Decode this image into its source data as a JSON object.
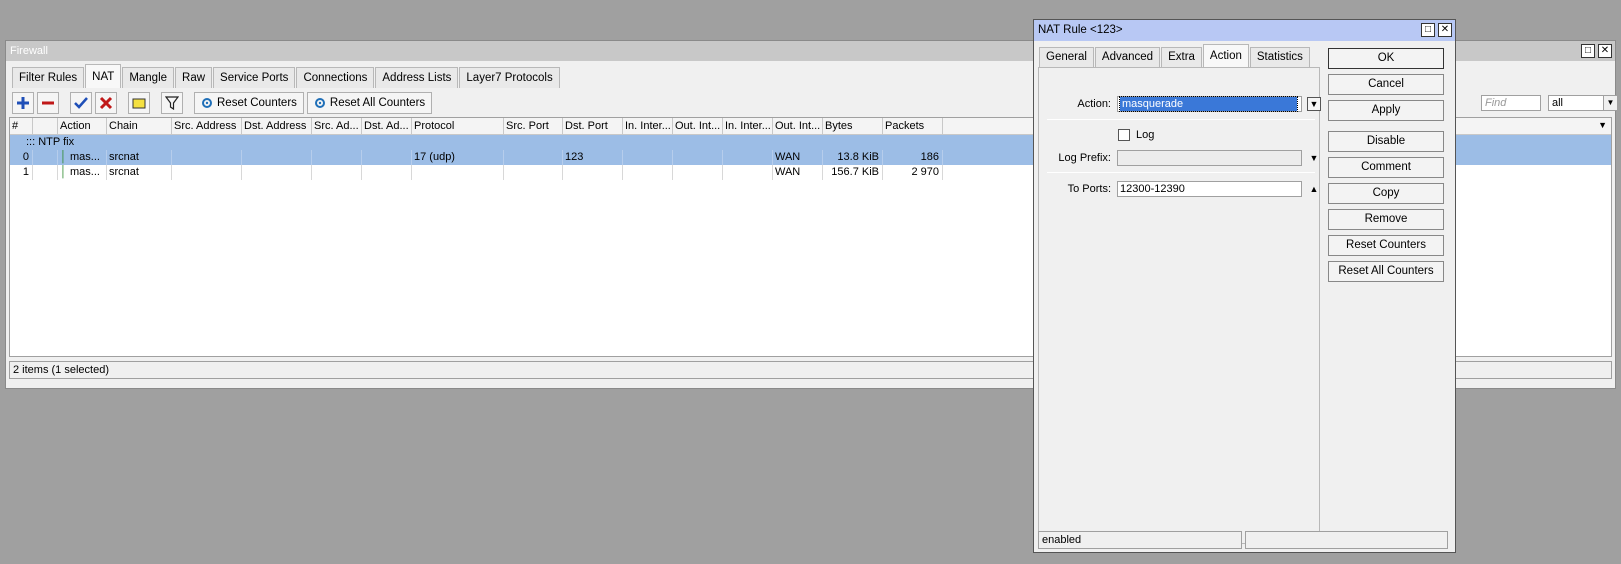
{
  "firewall": {
    "title": "Firewall",
    "tabs": [
      "Filter Rules",
      "NAT",
      "Mangle",
      "Raw",
      "Service Ports",
      "Connections",
      "Address Lists",
      "Layer7 Protocols"
    ],
    "active_tab": "NAT",
    "toolbar": {
      "reset_counters": "Reset Counters",
      "reset_all_counters": "Reset All Counters"
    },
    "find_placeholder": "Find",
    "filter_value": "all",
    "columns": [
      "#",
      "",
      "Action",
      "Chain",
      "Src. Address",
      "Dst. Address",
      "Src. Ad...",
      "Dst. Ad...",
      "Protocol",
      "Src. Port",
      "Dst. Port",
      "In. Inter...",
      "Out. Int...",
      "In. Inter...",
      "Out. Int...",
      "Bytes",
      "Packets"
    ],
    "comment_row": "::: NTP fix",
    "rows": [
      {
        "num": "0",
        "action": "mas...",
        "chain": "srcnat",
        "protocol": "17 (udp)",
        "dst_port": "123",
        "out_int": "WAN",
        "bytes": "13.8 KiB",
        "packets": "186",
        "selected": true
      },
      {
        "num": "1",
        "action": "mas...",
        "chain": "srcnat",
        "protocol": "",
        "dst_port": "",
        "out_int": "WAN",
        "bytes": "156.7 KiB",
        "packets": "2 970",
        "selected": false
      }
    ],
    "status": "2 items (1 selected)"
  },
  "nat_dialog": {
    "title": "NAT Rule <123>",
    "tabs": [
      "General",
      "Advanced",
      "Extra",
      "Action",
      "Statistics"
    ],
    "active_tab": "Action",
    "action_label": "Action:",
    "action_value": "masquerade",
    "log_label": "Log",
    "log_prefix_label": "Log Prefix:",
    "to_ports_label": "To Ports:",
    "to_ports_value": "12300-12390",
    "buttons": {
      "ok": "OK",
      "cancel": "Cancel",
      "apply": "Apply",
      "disable": "Disable",
      "comment": "Comment",
      "copy": "Copy",
      "remove": "Remove",
      "reset_counters": "Reset Counters",
      "reset_all_counters": "Reset All Counters"
    },
    "status": "enabled"
  },
  "colors": {
    "selection": "#9cbde6",
    "dialog_title": "#b8c8f4",
    "add_icon": "#1f4fb8",
    "remove_icon": "#c01818",
    "enable_icon": "#1f4fb8"
  }
}
